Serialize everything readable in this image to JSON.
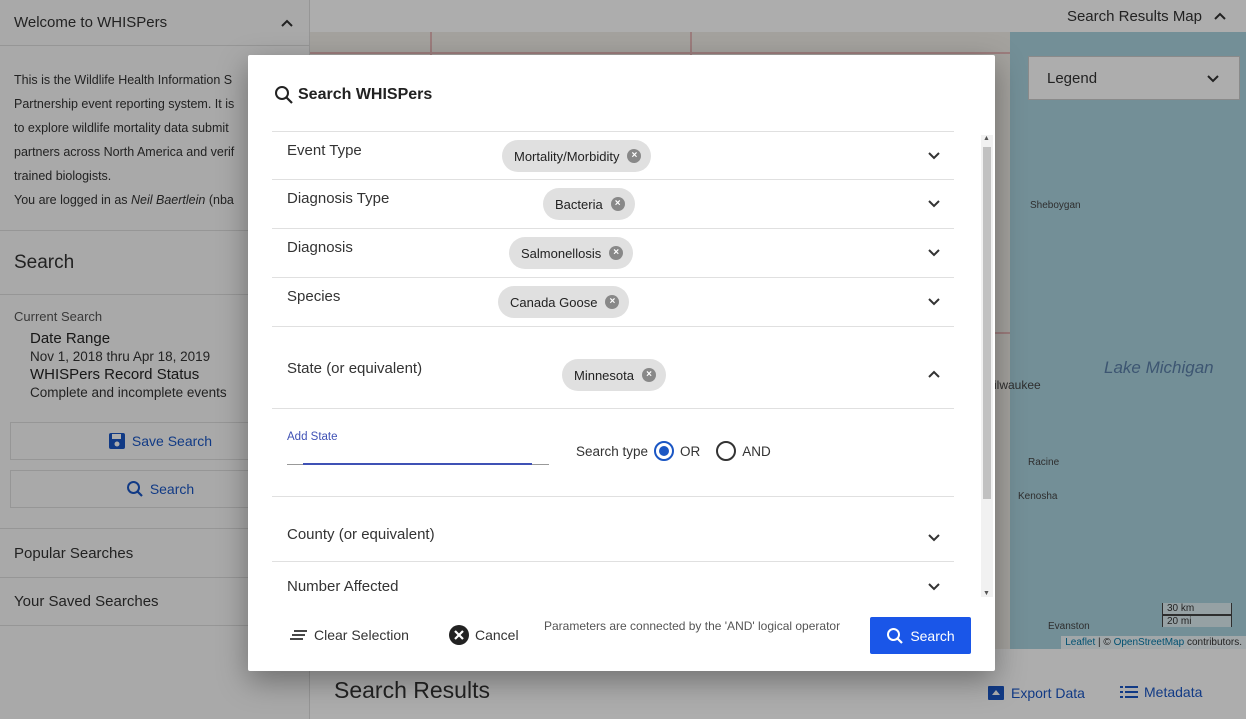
{
  "sidebar": {
    "welcome_title": "Welcome to WHISPers",
    "intro_lines": [
      "This is the Wildlife Health Information S",
      "Partnership event reporting system. It is",
      "to explore wildlife mortality data submit",
      "partners across North America and verif",
      "trained biologists."
    ],
    "logged_in_prefix": "You are logged in as",
    "logged_in_name": "Neil Baertlein",
    "logged_in_suffix": "(nba",
    "search_title": "Search",
    "current_search_label": "Current Search",
    "criteria": [
      {
        "title": "Date Range",
        "value": "Nov 1, 2018 thru Apr 18, 2019"
      },
      {
        "title": "WHISPers Record Status",
        "value": "Complete and incomplete events"
      }
    ],
    "save_search_label": "Save Search",
    "search_button_label": "Search",
    "popular_searches": "Popular Searches",
    "saved_searches": "Your Saved Searches"
  },
  "map": {
    "header_title": "Search Results Map",
    "legend_label": "Legend",
    "cities": [
      "Sheboygan",
      "ilwaukee",
      "Racine",
      "Kenosha",
      "Evanston"
    ],
    "lake_label": "Lake Michigan",
    "scale_km": "30 km",
    "scale_mi": "20 mi",
    "attribution_leaflet": "Leaflet",
    "attribution_sep": " | © ",
    "attribution_osm": "OpenStreetMap",
    "attribution_suffix": " contributors."
  },
  "results": {
    "title": "Search Results",
    "export_label": "Export Data",
    "metadata_label": "Metadata"
  },
  "dialog": {
    "title": "Search WHISPers",
    "rows": [
      {
        "label": "Event Type",
        "chip": "Mortality/Morbidity"
      },
      {
        "label": "Diagnosis Type",
        "chip": "Bacteria"
      },
      {
        "label": "Diagnosis",
        "chip": "Salmonellosis"
      },
      {
        "label": "Species",
        "chip": "Canada Goose"
      }
    ],
    "state": {
      "label": "State (or equivalent)",
      "chip": "Minnesota"
    },
    "add_state_label": "Add State",
    "search_type_label": "Search type",
    "search_type_options": [
      "OR",
      "AND"
    ],
    "search_type_selected": "OR",
    "county_label": "County (or equivalent)",
    "number_affected_label": "Number Affected",
    "clear_label": "Clear Selection",
    "cancel_label": "Cancel",
    "note": "Parameters are connected by the 'AND' logical operator",
    "search_label": "Search"
  },
  "colors": {
    "accent": "#1a56e8",
    "link": "#1a56c4",
    "chip": "#e0e0e0",
    "lake": "#aad3df"
  }
}
